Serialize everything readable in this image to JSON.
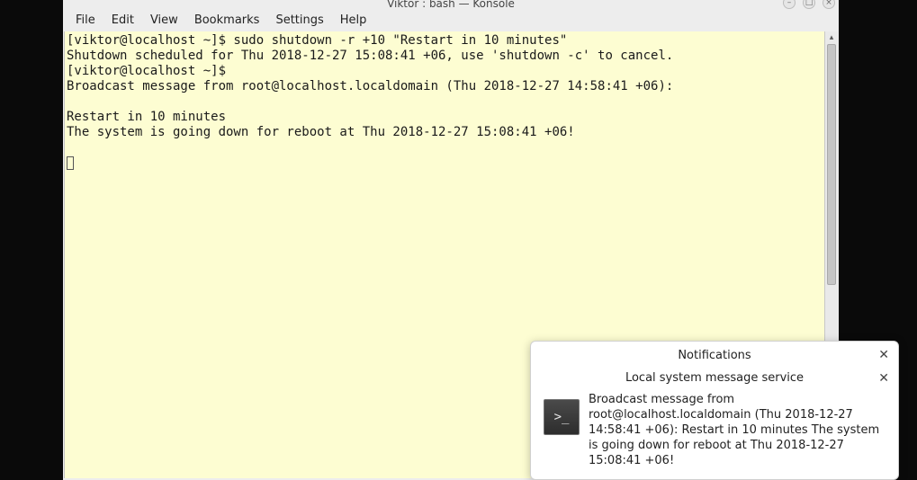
{
  "window": {
    "title": "Viktor : bash — Konsole",
    "wm_buttons": {
      "min": "–",
      "max": "□",
      "close": "×"
    }
  },
  "menubar": {
    "file": "File",
    "edit": "Edit",
    "view": "View",
    "bookmarks": "Bookmarks",
    "settings": "Settings",
    "help": "Help"
  },
  "terminal": {
    "lines": [
      "[viktor@localhost ~]$ sudo shutdown -r +10 \"Restart in 10 minutes\"",
      "Shutdown scheduled for Thu 2018-12-27 15:08:41 +06, use 'shutdown -c' to cancel.",
      "[viktor@localhost ~]$ ",
      "Broadcast message from root@localhost.localdomain (Thu 2018-12-27 14:58:41 +06):",
      "",
      "Restart in 10 minutes",
      "The system is going down for reboot at Thu 2018-12-27 15:08:41 +06!",
      ""
    ]
  },
  "notification": {
    "header": "Notifications",
    "subheader": "Local system message service",
    "icon_glyph": ">_",
    "body": "Broadcast message from root@localhost.localdomain (Thu 2018-12-27 14:58:41 +06): Restart in 10 minutes The system is going down for reboot at Thu 2018-12-27 15:08:41 +06!",
    "close": "✕"
  }
}
